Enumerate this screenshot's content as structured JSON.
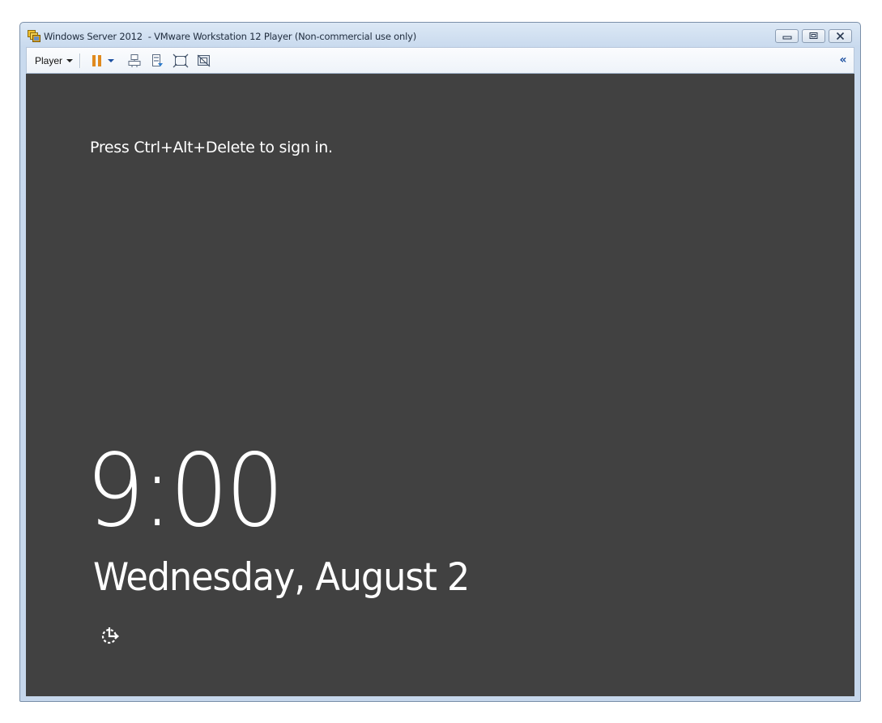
{
  "window": {
    "title": "Windows Server 2012  - VMware Workstation 12 Player (Non-commercial use only)",
    "app_icon": "vmware-player-icon",
    "controls": {
      "minimize_icon": "minimize-icon",
      "restore_icon": "restore-icon",
      "close_icon": "close-icon"
    }
  },
  "toolbar": {
    "player_menu_label": "Player",
    "icons": [
      {
        "name": "pause-icon",
        "color": "#e08a1e"
      },
      {
        "name": "dropdown-arrow-icon"
      },
      {
        "name": "send-ctrl-alt-del-icon"
      },
      {
        "name": "removable-devices-icon"
      },
      {
        "name": "fit-guest-icon"
      },
      {
        "name": "unity-icon"
      }
    ],
    "collapse_label": "«"
  },
  "lock_screen": {
    "prompt": "Press Ctrl+Alt+Delete to sign in.",
    "time": "9:00",
    "date": "Wednesday, August 2",
    "ease_of_access_icon": "ease-of-access-icon",
    "background_color": "#414141"
  }
}
